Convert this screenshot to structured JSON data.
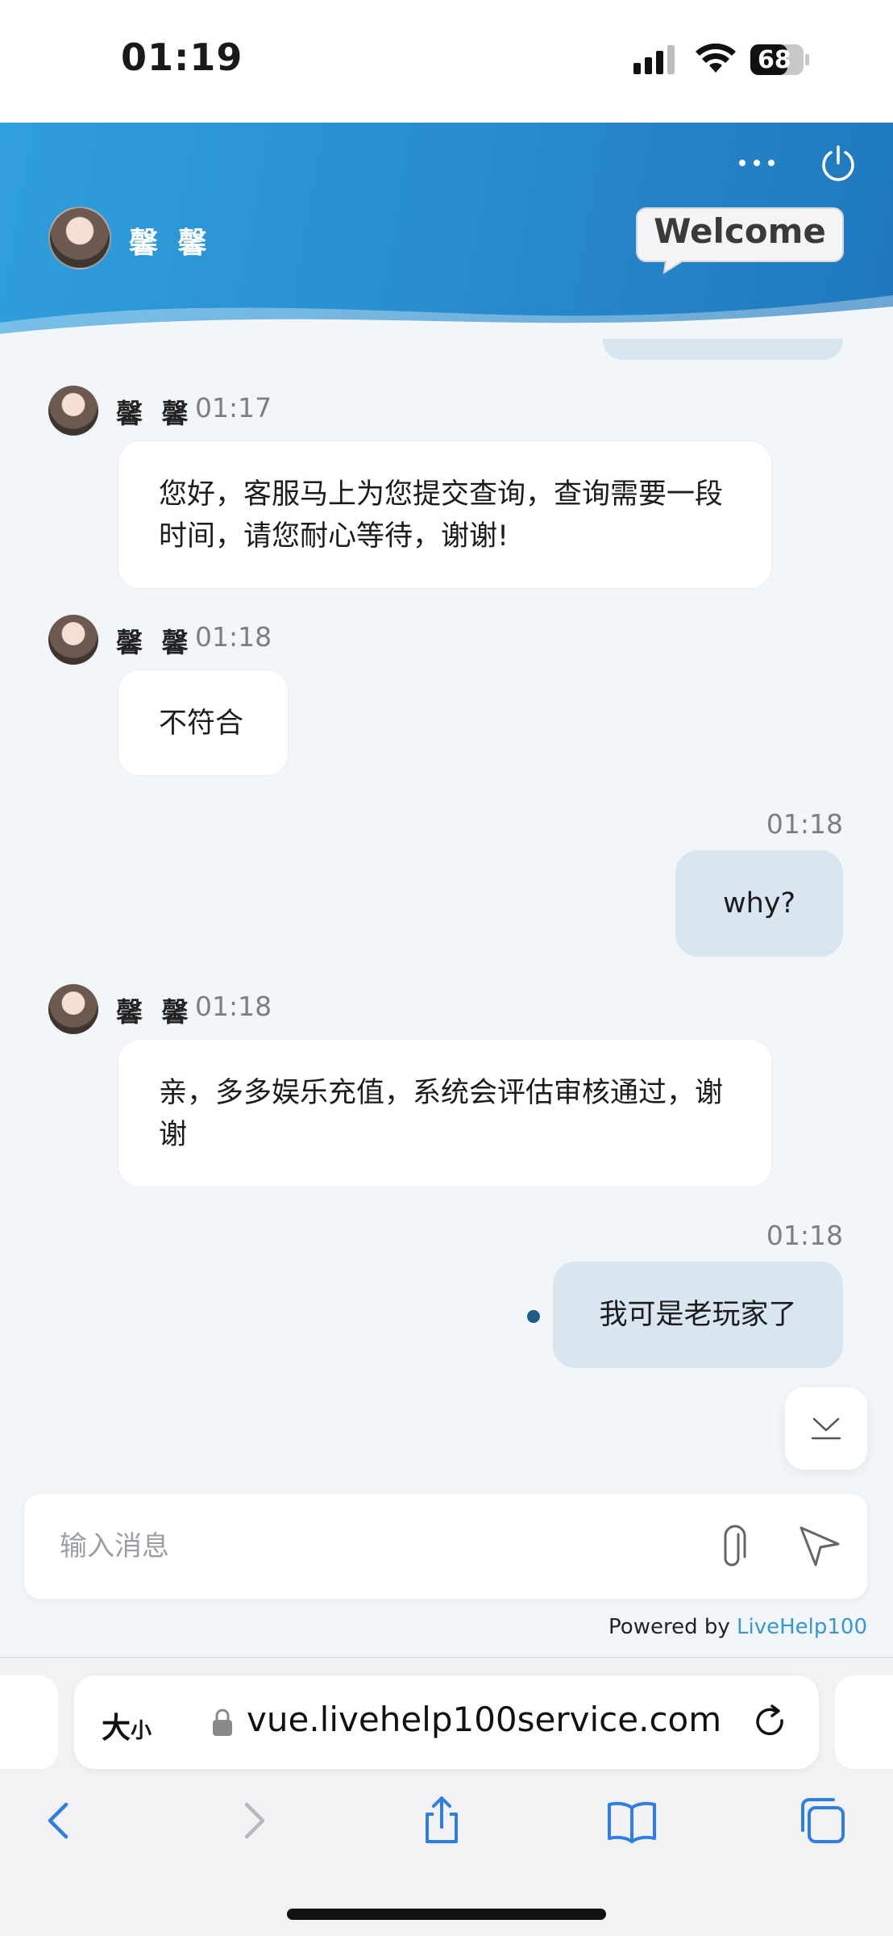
{
  "status_bar": {
    "time": "01:19",
    "battery": "68"
  },
  "header": {
    "agent_name": "馨 馨",
    "welcome_badge": "Welcome"
  },
  "messages": [
    {
      "side": "left",
      "name": "馨 馨",
      "time": "01:17",
      "text": "您好，客服马上为您提交查询，查询需要一段时间，请您耐心等待，谢谢!"
    },
    {
      "side": "left",
      "name": "馨 馨",
      "time": "01:18",
      "text": "不符合"
    },
    {
      "side": "right",
      "time": "01:18",
      "text": "why?"
    },
    {
      "side": "left",
      "name": "馨 馨",
      "time": "01:18",
      "text": "亲，多多娱乐充值，系统会评估审核通过，谢谢"
    },
    {
      "side": "right",
      "time": "01:18",
      "text": "我可是老玩家了"
    }
  ],
  "composer": {
    "placeholder": "输入消息"
  },
  "footer": {
    "powered_by": "Powered by ",
    "brand": "LiveHelp100"
  },
  "browser": {
    "text_size_big": "大",
    "text_size_small": "小",
    "url": "vue.livehelp100service.com"
  },
  "colors": {
    "header_blue": "#2a8fd0",
    "bubble_self": "#d9e6f1",
    "link_blue": "#3a95d2",
    "ios_blue": "#2f7fe0"
  }
}
